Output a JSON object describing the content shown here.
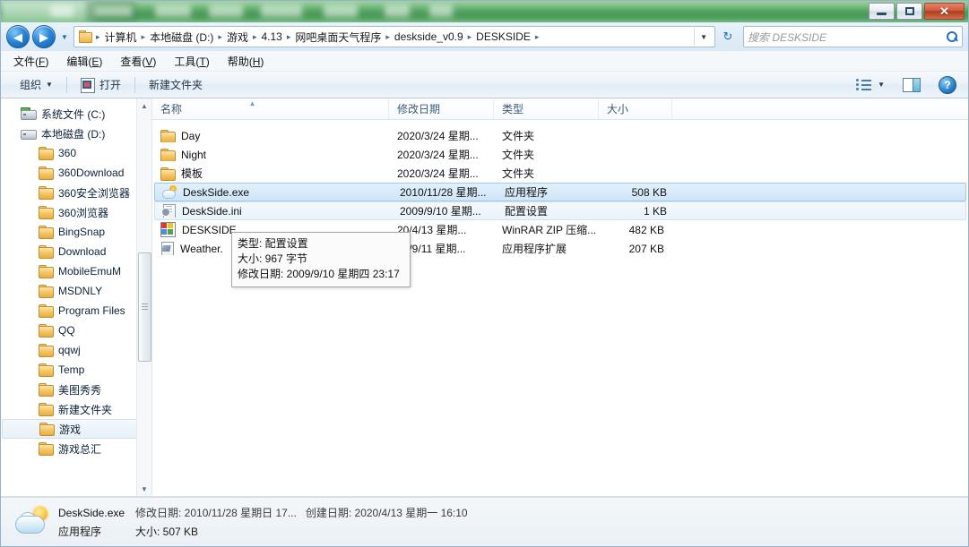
{
  "window": {
    "titlebar_ghost_note": "",
    "buttons": {
      "minimize": "–",
      "maximize": "□",
      "close": "✕"
    }
  },
  "address_bar": {
    "back_label": "◀",
    "forward_label": "▶",
    "history_caret": "▼",
    "folder_icon": "folder-icon",
    "crumbs": [
      "计算机",
      "本地磁盘 (D:)",
      "游戏",
      "4.13",
      "网吧桌面天气程序",
      "deskside_v0.9",
      "DESKSIDE"
    ],
    "separator": "▸",
    "dropdown_caret": "▼",
    "refresh_label": "↻",
    "search_placeholder": "搜索 DESKSIDE"
  },
  "menubar": {
    "items": [
      {
        "text": "文件(",
        "key": "F",
        "tail": ")"
      },
      {
        "text": "编辑(",
        "key": "E",
        "tail": ")"
      },
      {
        "text": "查看(",
        "key": "V",
        "tail": ")"
      },
      {
        "text": "工具(",
        "key": "T",
        "tail": ")"
      },
      {
        "text": "帮助(",
        "key": "H",
        "tail": ")"
      }
    ]
  },
  "toolbar": {
    "organize_label": "组织",
    "organize_caret": "▼",
    "open_label": "打开",
    "new_folder_label": "新建文件夹",
    "view_caret": "▼",
    "help_label": "?"
  },
  "nav_pane": {
    "items": [
      {
        "label": "系统文件 (C:)",
        "type": "sysdrive",
        "indent": false,
        "selected": false
      },
      {
        "label": "本地磁盘 (D:)",
        "type": "drive",
        "indent": false,
        "selected": false
      },
      {
        "label": "360",
        "type": "folder",
        "indent": true,
        "selected": false
      },
      {
        "label": "360Download",
        "type": "folder",
        "indent": true,
        "selected": false
      },
      {
        "label": "360安全浏览器",
        "type": "folder",
        "indent": true,
        "selected": false
      },
      {
        "label": "360浏览器",
        "type": "folder",
        "indent": true,
        "selected": false
      },
      {
        "label": "BingSnap",
        "type": "folder",
        "indent": true,
        "selected": false
      },
      {
        "label": "Download",
        "type": "folder",
        "indent": true,
        "selected": false
      },
      {
        "label": "MobileEmuM",
        "type": "folder",
        "indent": true,
        "selected": false
      },
      {
        "label": "MSDNLY",
        "type": "folder",
        "indent": true,
        "selected": false
      },
      {
        "label": "Program Files",
        "type": "folder",
        "indent": true,
        "selected": false
      },
      {
        "label": "QQ",
        "type": "folder",
        "indent": true,
        "selected": false
      },
      {
        "label": "qqwj",
        "type": "folder",
        "indent": true,
        "selected": false
      },
      {
        "label": "Temp",
        "type": "folder",
        "indent": true,
        "selected": false
      },
      {
        "label": "美图秀秀",
        "type": "folder",
        "indent": true,
        "selected": false
      },
      {
        "label": "新建文件夹",
        "type": "folder",
        "indent": true,
        "selected": false
      },
      {
        "label": "游戏",
        "type": "folder",
        "indent": true,
        "selected": true
      },
      {
        "label": "游戏总汇",
        "type": "folder",
        "indent": true,
        "selected": false
      }
    ],
    "scroll_up": "▲",
    "scroll_down": "▼"
  },
  "file_list": {
    "columns": [
      {
        "label": "名称",
        "sorted": "asc",
        "sort_glyph": "▲"
      },
      {
        "label": "修改日期",
        "sorted": "",
        "sort_glyph": ""
      },
      {
        "label": "类型",
        "sorted": "",
        "sort_glyph": ""
      },
      {
        "label": "大小",
        "sorted": "",
        "sort_glyph": ""
      }
    ],
    "rows": [
      {
        "name": "Day",
        "date": "2020/3/24 星期...",
        "type": "文件夹",
        "size": "",
        "icon": "folder",
        "state": ""
      },
      {
        "name": "Night",
        "date": "2020/3/24 星期...",
        "type": "文件夹",
        "size": "",
        "icon": "folder",
        "state": ""
      },
      {
        "name": "模板",
        "date": "2020/3/24 星期...",
        "type": "文件夹",
        "size": "",
        "icon": "folder",
        "state": ""
      },
      {
        "name": "DeskSide.exe",
        "date": "2010/11/28 星期...",
        "type": "应用程序",
        "size": "508 KB",
        "icon": "exe",
        "state": "selected"
      },
      {
        "name": "DeskSide.ini",
        "date": "2009/9/10 星期...",
        "type": "配置设置",
        "size": "1 KB",
        "icon": "ini",
        "state": "hover"
      },
      {
        "name": "DESKSIDE",
        "date": "20/4/13 星期...",
        "type": "WinRAR ZIP 压缩...",
        "size": "482 KB",
        "icon": "zip",
        "state": ""
      },
      {
        "name": "Weather.",
        "date": "09/9/11 星期...",
        "type": "应用程序扩展",
        "size": "207 KB",
        "icon": "dll",
        "state": ""
      }
    ]
  },
  "tooltip": {
    "line1": "类型: 配置设置",
    "line2": "大小: 967 字节",
    "line3": "修改日期: 2009/9/10 星期四 23:17"
  },
  "status_bar": {
    "file_name": "DeskSide.exe",
    "modified_label": "修改日期: 2010/11/28 星期日 17...",
    "created_label": "创建日期: 2020/4/13 星期一 16:10",
    "kind": "应用程序",
    "size_label": "大小: 507 KB"
  },
  "colors": {
    "title_green": "#3f9a4f",
    "close_red": "#cf5b3c",
    "selection_blue": "#cfe5f8",
    "accent_blue": "#2a86d8"
  }
}
